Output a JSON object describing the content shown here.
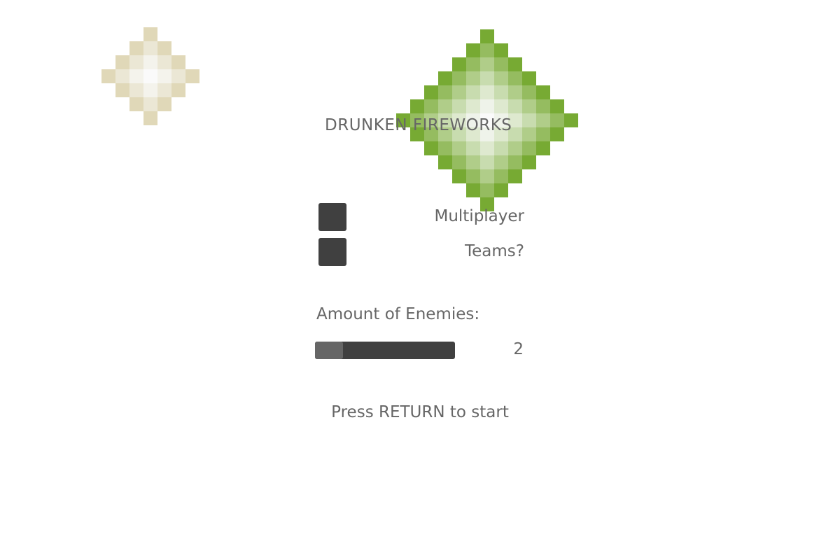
{
  "game": {
    "title": "DRUNKEN FIREWORKS",
    "options": {
      "multiplayer_label": "Multiplayer",
      "teams_label": "Teams?"
    },
    "enemies": {
      "label": "Amount of Enemies:",
      "value": "2",
      "slider_fraction": 0.2
    },
    "start_hint": "Press RETURN to start"
  },
  "colors": {
    "text": "#666666",
    "ui_dark": "#404040",
    "ui_handle": "#666666",
    "green_firework": "#77aa33",
    "cream_firework": "#e0d8b8"
  },
  "icons": {
    "small_firework": "cream-firework-burst",
    "large_firework": "green-firework-burst"
  }
}
